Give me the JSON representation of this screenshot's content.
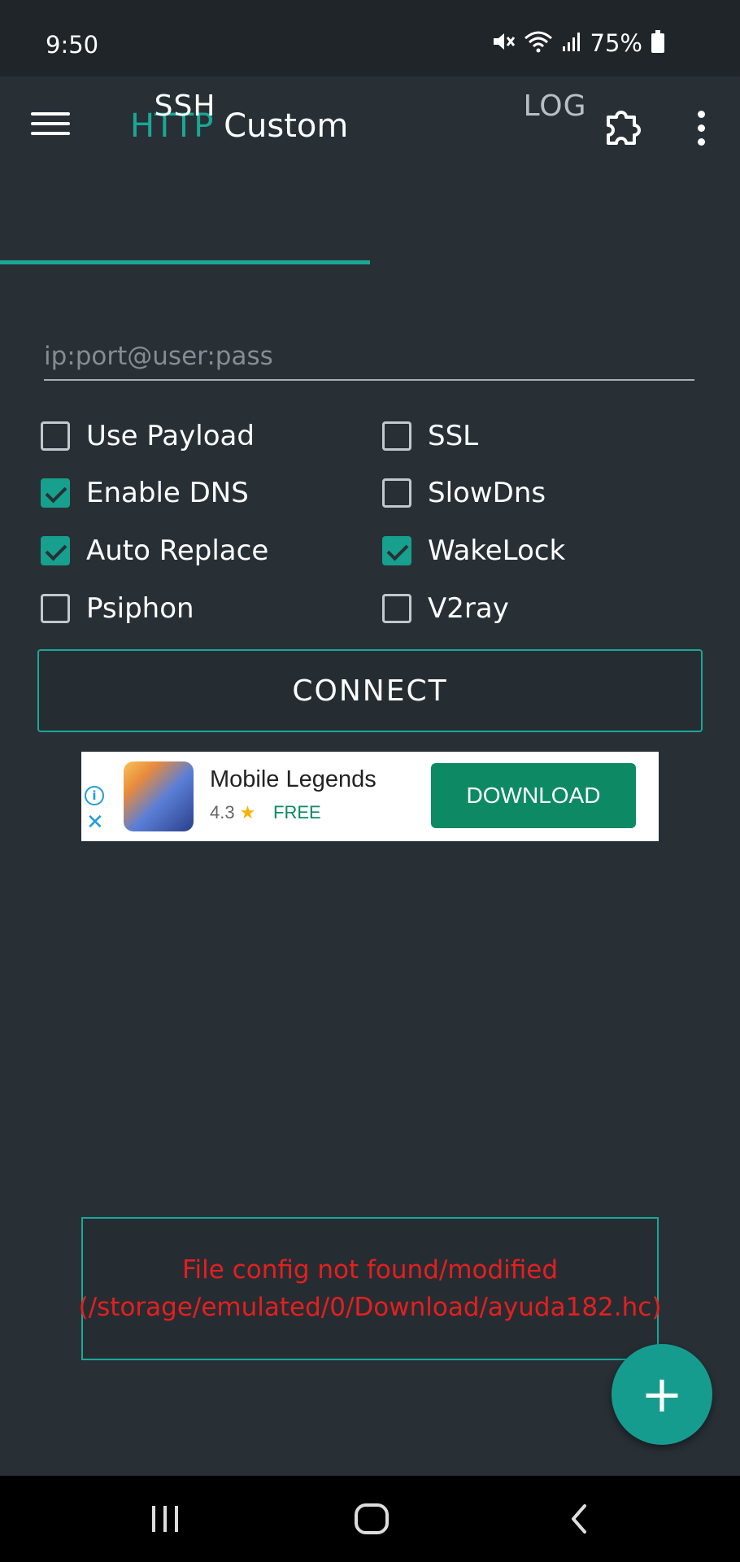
{
  "status_bar": {
    "time": "9:50",
    "battery_percent": "75%",
    "icons": [
      "mute-icon",
      "wifi-icon",
      "signal-icon",
      "battery-icon"
    ]
  },
  "app_bar": {
    "title_part1": "HTTP",
    "title_part2": " Custom",
    "menu_icon": "hamburger-menu-icon",
    "plugin_icon": "puzzle-icon",
    "more_icon": "more-vertical-icon"
  },
  "tabs": [
    {
      "label": "SSH",
      "active": true
    },
    {
      "label": "LOG",
      "active": false
    }
  ],
  "ssh_input": {
    "placeholder": "ip:port@user:pass",
    "value": ""
  },
  "options": [
    {
      "label": "Use Payload",
      "checked": false
    },
    {
      "label": "SSL",
      "checked": false
    },
    {
      "label": "Enable DNS",
      "checked": true
    },
    {
      "label": "SlowDns",
      "checked": false
    },
    {
      "label": "Auto Replace",
      "checked": true
    },
    {
      "label": "WakeLock",
      "checked": true
    },
    {
      "label": "Psiphon",
      "checked": false
    },
    {
      "label": "V2ray",
      "checked": false
    }
  ],
  "connect_label": "CONNECT",
  "ad": {
    "app_name": "Mobile Legends",
    "rating": "4.3",
    "price": "FREE",
    "cta": "DOWNLOAD"
  },
  "error_message": "File config not found/modified (/storage/emulated/0/Download/ayuda182.hc)",
  "fab_label": "+",
  "colors": {
    "accent": "#1aa798",
    "background": "#283036",
    "error": "#e51f1f",
    "ad_cta": "#0d8a64"
  }
}
